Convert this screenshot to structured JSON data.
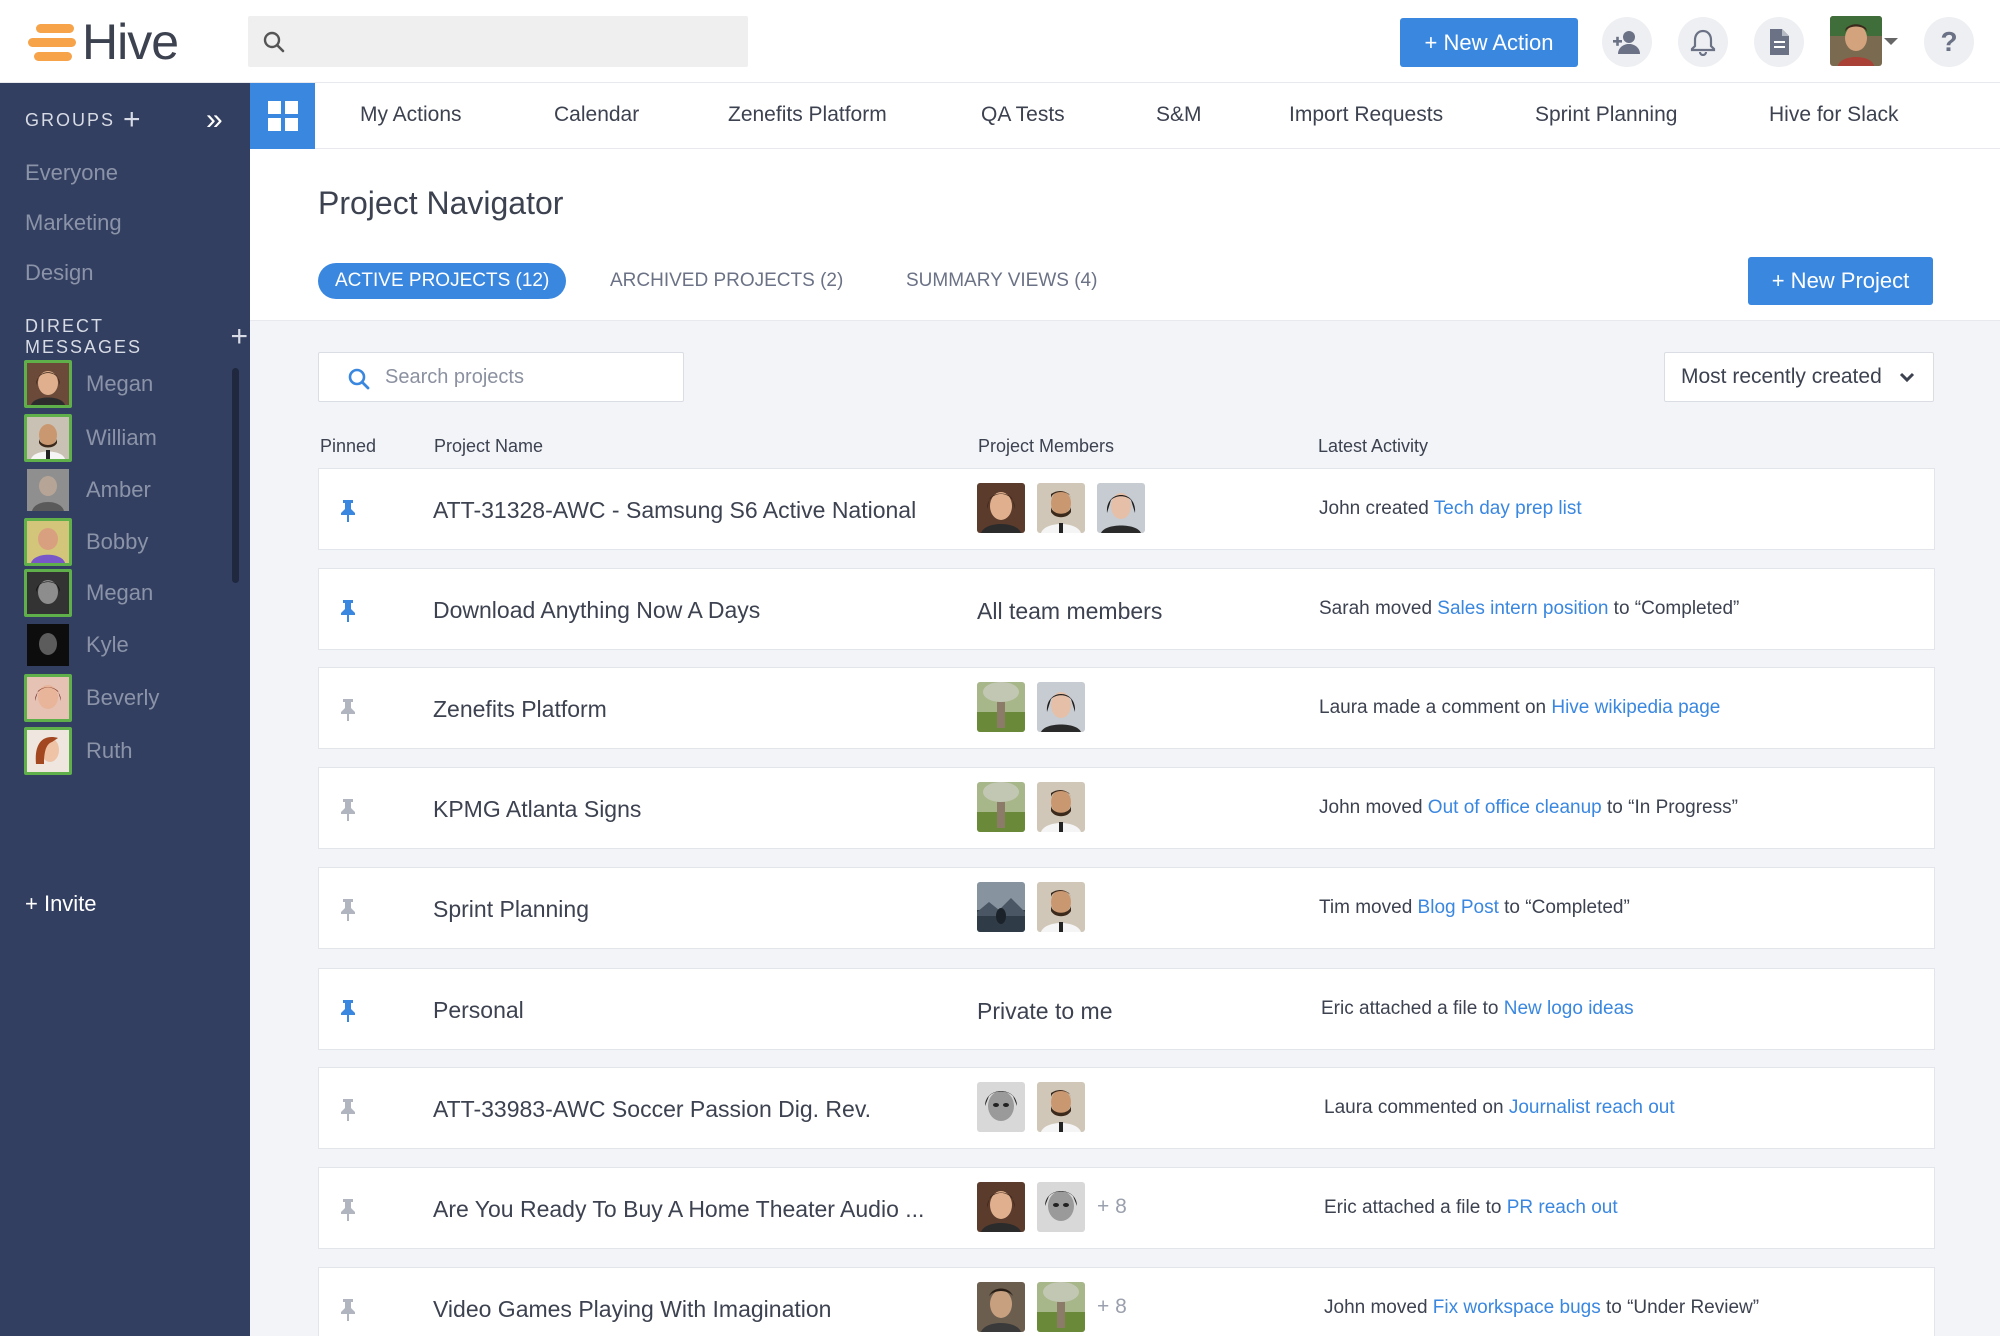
{
  "app": {
    "logo_text": "Hive"
  },
  "header": {
    "search_placeholder": "",
    "new_action_label": "+ New Action",
    "help_label": "?"
  },
  "sidebar": {
    "groups_heading": "GROUPS",
    "groups_add": "+",
    "collapse_label": "»",
    "groups": [
      "Everyone",
      "Marketing",
      "Design"
    ],
    "dm_heading": "DIRECT MESSAGES",
    "dm_add": "+",
    "direct_messages": [
      {
        "name": "Megan",
        "online": true
      },
      {
        "name": "William",
        "online": true
      },
      {
        "name": "Amber",
        "online": false
      },
      {
        "name": "Bobby",
        "online": true
      },
      {
        "name": "Megan",
        "online": true
      },
      {
        "name": "Kyle",
        "online": false
      },
      {
        "name": "Beverly",
        "online": true
      },
      {
        "name": "Ruth",
        "online": true
      }
    ],
    "invite_label": "+ Invite"
  },
  "tabs": [
    "My Actions",
    "Calendar",
    "Zenefits Platform",
    "QA Tests",
    "S&M",
    "Import Requests",
    "Sprint Planning",
    "Hive for Slack"
  ],
  "main": {
    "title": "Project Navigator",
    "project_tabs": [
      "ACTIVE PROJECTS (12)",
      "ARCHIVED PROJECTS (2)",
      "SUMMARY VIEWS (4)"
    ],
    "new_project_label": "+ New Project",
    "search_placeholder": "Search projects",
    "sort_value": "Most recently created",
    "columns": [
      "Pinned",
      "Project Name",
      "Project Members",
      "Latest Activity"
    ]
  },
  "projects": [
    {
      "name": "ATT-31328-AWC - Samsung S6 Active National",
      "pinned": true,
      "members": [
        "woman-brown",
        "man-beard",
        "woman-dark"
      ],
      "members_text": "",
      "more": "",
      "activity": {
        "pre": "John created ",
        "link": "Tech day prep list",
        "post": ""
      }
    },
    {
      "name": "Download Anything Now A Days",
      "pinned": true,
      "members": [],
      "members_text": "All team members",
      "more": "",
      "activity": {
        "pre": "Sarah moved ",
        "link": "Sales intern position",
        "post": " to “Completed”"
      }
    },
    {
      "name": "Zenefits Platform",
      "pinned": false,
      "members": [
        "tree",
        "woman-dark"
      ],
      "members_text": "",
      "more": "",
      "activity": {
        "pre": "Laura made a comment on ",
        "link": "Hive wikipedia page",
        "post": ""
      }
    },
    {
      "name": "KPMG Atlanta Signs",
      "pinned": false,
      "members": [
        "tree",
        "man-beard"
      ],
      "members_text": "",
      "more": "",
      "activity": {
        "pre": "John moved ",
        "link": "Out of office cleanup",
        "post": " to “In Progress”"
      }
    },
    {
      "name": "Sprint Planning",
      "pinned": false,
      "members": [
        "landscape",
        "man-beard"
      ],
      "members_text": "",
      "more": "",
      "activity": {
        "pre": "Tim moved ",
        "link": "Blog Post",
        "post": " to “Completed”"
      }
    },
    {
      "name": "Personal",
      "pinned": true,
      "members": [],
      "members_text": "Private to me",
      "more": "",
      "activity": {
        "pre": "Eric attached a file to ",
        "link": "New logo ideas",
        "post": ""
      }
    },
    {
      "name": "ATT-33983-AWC Soccer Passion Dig. Rev.",
      "pinned": false,
      "members": [
        "bw-face",
        "man-beard"
      ],
      "members_text": "",
      "more": "",
      "activity": {
        "pre": "Laura commented on ",
        "link": "Journalist reach out",
        "post": ""
      }
    },
    {
      "name": "Are You Ready To Buy A Home Theater Audio ...",
      "pinned": false,
      "members": [
        "woman-brown",
        "bw-face"
      ],
      "members_text": "",
      "more": "+ 8",
      "activity": {
        "pre": "Eric attached a file to ",
        "link": "PR reach out",
        "post": ""
      }
    },
    {
      "name": "Video Games Playing With Imagination",
      "pinned": false,
      "members": [
        "man-dark",
        "tree"
      ],
      "members_text": "",
      "more": "+ 8",
      "activity": {
        "pre": "John moved ",
        "link": "Fix workspace bugs",
        "post": " to “Under Review”"
      }
    }
  ],
  "colors": {
    "accent": "#3a87e0",
    "sidebar": "#333f60",
    "online": "#5fb04a",
    "logo": "#f6a34a"
  }
}
